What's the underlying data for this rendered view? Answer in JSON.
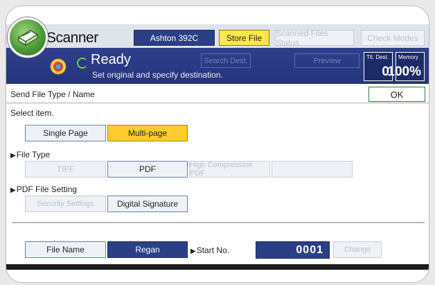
{
  "header": {
    "app_title": "Scanner",
    "destination_label": "Ashton 392C",
    "store_file_label": "Store File",
    "scanned_files_status_label": "Scanned Files Status",
    "check_modes_label": "Check Modes"
  },
  "status": {
    "state": "Ready",
    "message": "Set original and specify destination.",
    "search_dest_label": "Search Dest.",
    "preview_label": "Preview",
    "total_dest": {
      "label": "Ttl. Dest.",
      "value": "0"
    },
    "memory": {
      "label": "Memory",
      "value": "100%"
    }
  },
  "panel": {
    "title": "Send File Type / Name",
    "ok_label": "OK",
    "select_item_label": "Select item.",
    "page_mode": {
      "single_label": "Single Page",
      "multi_label": "Multi-page",
      "selected": "Multi-page"
    },
    "file_type": {
      "heading": "File Type",
      "options": [
        "TIFF",
        "PDF",
        "High Compression PDF",
        ""
      ]
    },
    "pdf_setting": {
      "heading": "PDF File Setting",
      "security_label": "Security Settings",
      "signature_label": "Digital Signature"
    },
    "file_name_label": "File Name",
    "file_name_value": "Regan",
    "start_no_label": "Start No.",
    "start_no_value": "0001",
    "change_label": "Change"
  },
  "colors": {
    "accent_dark_blue": "#2b3f86",
    "selected_yellow": "#ffcc2a",
    "store_file_yellow": "#ffe84a",
    "ok_border_green": "#2d7a3a"
  },
  "icons": [
    "scanner-app-icon",
    "status-icon",
    "ready-ring-icon",
    "arrow-right-icon"
  ]
}
